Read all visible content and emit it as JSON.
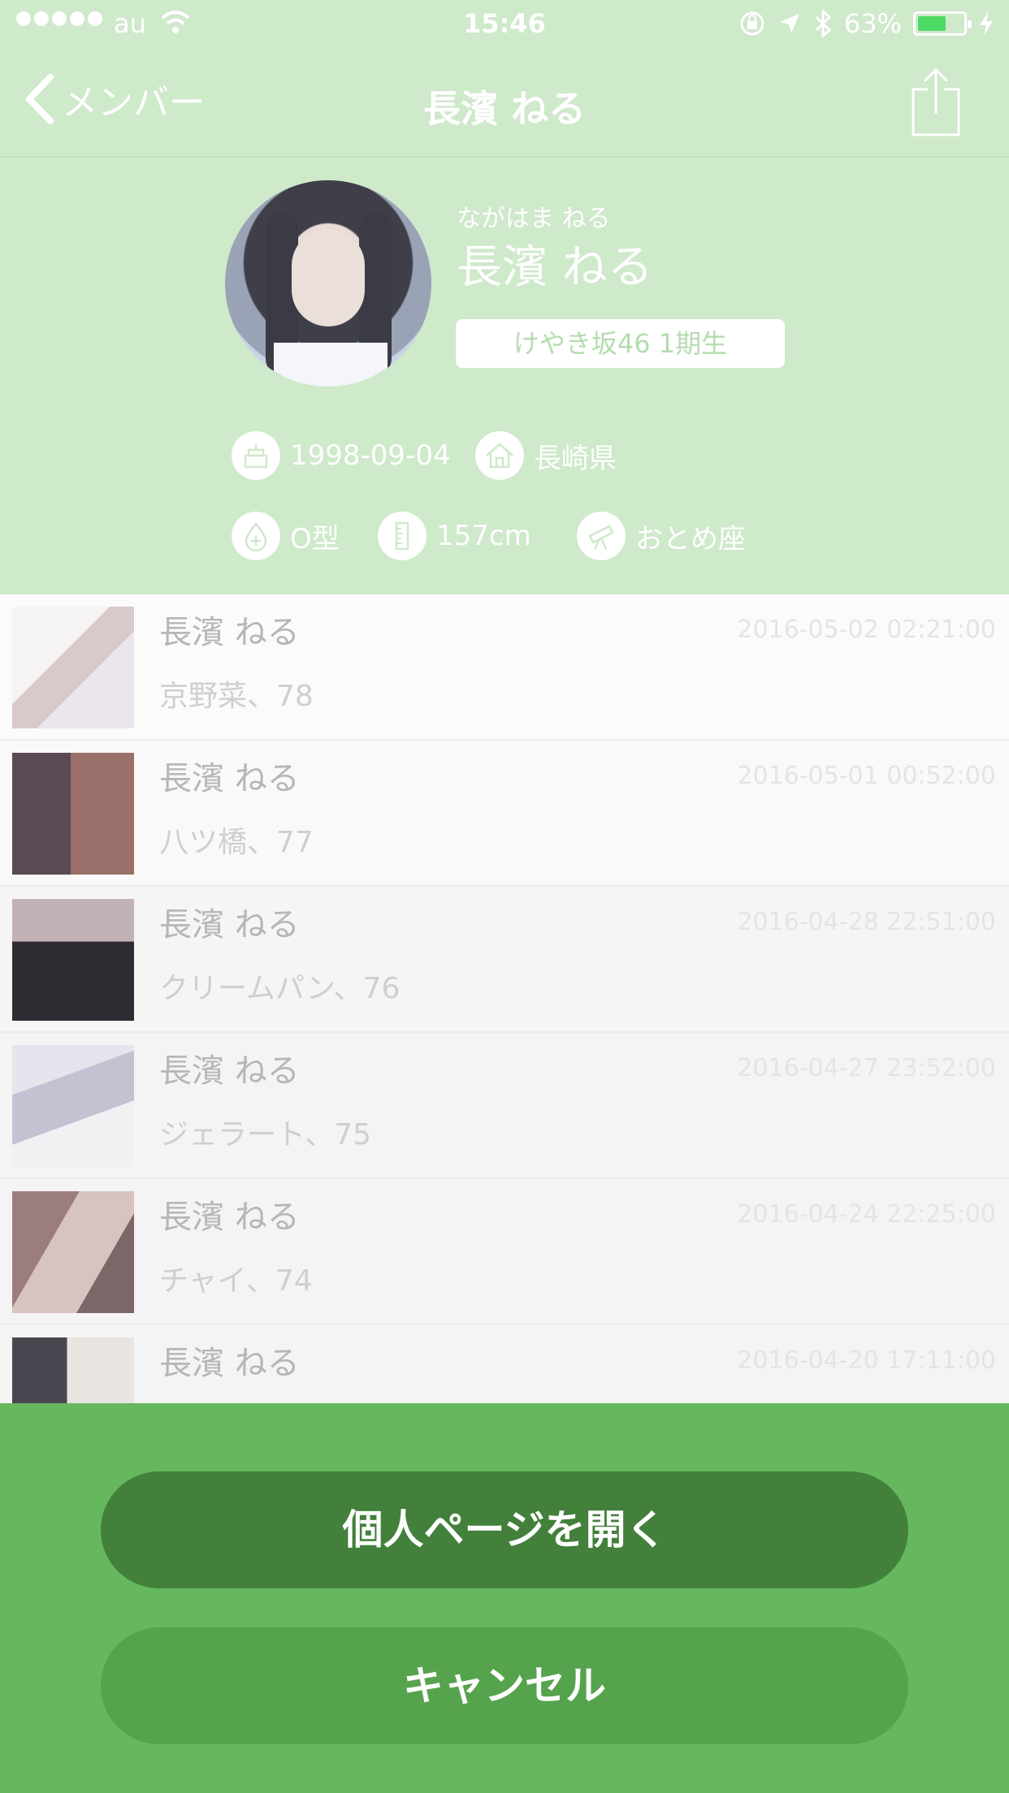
{
  "status_bar": {
    "carrier": "au",
    "time": "15:46",
    "battery": "63%",
    "battery_level": 0.63,
    "battery_color": "#4cd964"
  },
  "nav": {
    "back_label": "メンバー",
    "title": "長濱 ねる",
    "share_icon": "share-icon"
  },
  "profile": {
    "kana": "ながはま ねる",
    "name": "長濱 ねる",
    "generation": "けやき坂46 1期生",
    "birthday": "1998-09-04",
    "hometown": "長崎県",
    "blood_type": "O型",
    "height": "157cm",
    "constellation": "おとめ座"
  },
  "posts": [
    {
      "author": "長濱 ねる",
      "title": "京野菜、78",
      "date": "2016-05-02 02:21:00"
    },
    {
      "author": "長濱 ねる",
      "title": "八ツ橋、77",
      "date": "2016-05-01 00:52:00"
    },
    {
      "author": "長濱 ねる",
      "title": "クリームパン、76",
      "date": "2016-04-28 22:51:00"
    },
    {
      "author": "長濱 ねる",
      "title": "ジェラート、75",
      "date": "2016-04-27 23:52:00"
    },
    {
      "author": "長濱 ねる",
      "title": "チャイ、74",
      "date": "2016-04-24 22:25:00"
    },
    {
      "author": "長濱 ねる",
      "title": "",
      "date": "2016-04-20 17:11:00"
    }
  ],
  "action_sheet": {
    "open_label": "個人ページを開く",
    "cancel_label": "キャンセル"
  },
  "colors": {
    "brand_green": "#66b85e",
    "header_green": "#cfe9cb",
    "primary_button": "#42803b"
  }
}
